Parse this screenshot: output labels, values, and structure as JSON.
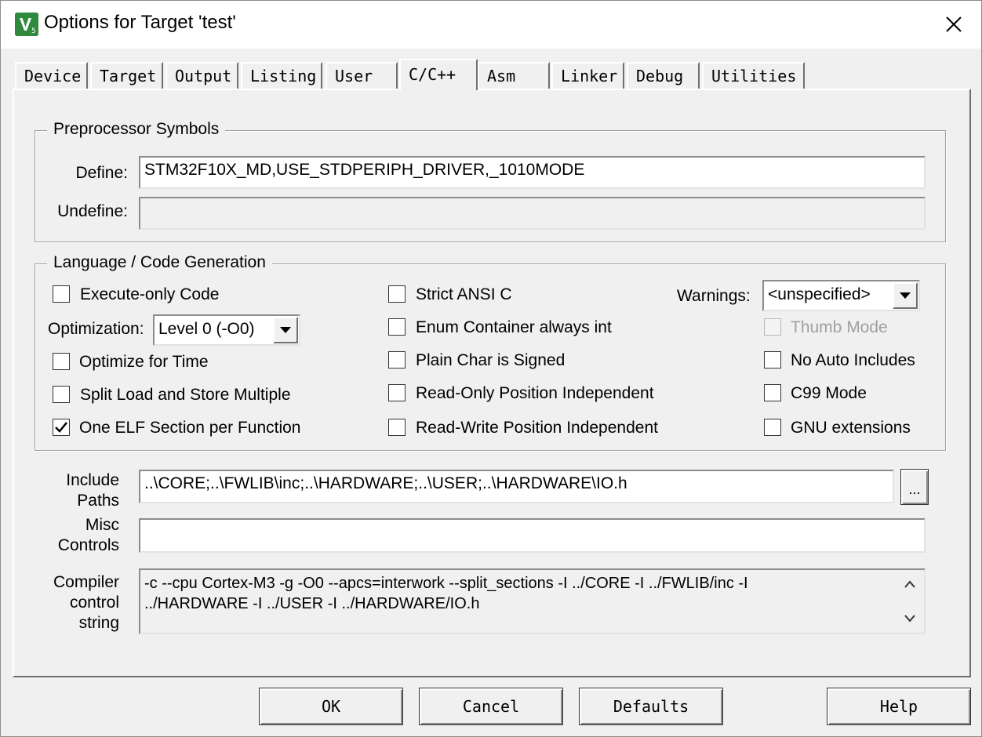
{
  "window": {
    "title": "Options for Target 'test'"
  },
  "tabs": [
    {
      "label": "Device"
    },
    {
      "label": "Target"
    },
    {
      "label": "Output"
    },
    {
      "label": "Listing"
    },
    {
      "label": "User"
    },
    {
      "label": "C/C++",
      "active": true
    },
    {
      "label": "Asm"
    },
    {
      "label": "Linker"
    },
    {
      "label": "Debug"
    },
    {
      "label": "Utilities"
    }
  ],
  "preprocessor": {
    "title": "Preprocessor Symbols",
    "define_label": "Define:",
    "define_value": "STM32F10X_MD,USE_STDPERIPH_DRIVER,_1010MODE",
    "undefine_label": "Undefine:",
    "undefine_value": ""
  },
  "language": {
    "title": "Language / Code Generation",
    "execute_only": {
      "label": "Execute-only Code",
      "checked": false
    },
    "optimization_label": "Optimization:",
    "optimization_value": "Level 0 (-O0)",
    "optimize_time": {
      "label": "Optimize for Time",
      "checked": false
    },
    "split_load": {
      "label": "Split Load and Store Multiple",
      "checked": false
    },
    "one_elf": {
      "label": "One ELF Section per Function",
      "checked": true
    },
    "strict_ansi": {
      "label": "Strict ANSI C",
      "checked": false
    },
    "enum_container": {
      "label": "Enum Container always int",
      "checked": false
    },
    "plain_char": {
      "label": "Plain Char is Signed",
      "checked": false
    },
    "ropi": {
      "label": "Read-Only Position Independent",
      "checked": false
    },
    "rwpi": {
      "label": "Read-Write Position Independent",
      "checked": false
    },
    "warnings_label": "Warnings:",
    "warnings_value": "<unspecified>",
    "thumb_mode": {
      "label": "Thumb Mode",
      "checked": false,
      "disabled": true
    },
    "no_auto_includes": {
      "label": "No Auto Includes",
      "checked": false
    },
    "c99_mode": {
      "label": "C99 Mode",
      "checked": false
    },
    "gnu_ext": {
      "label": "GNU extensions",
      "checked": false
    }
  },
  "include": {
    "label_line1": "Include",
    "label_line2": "Paths",
    "value": "..\\CORE;..\\FWLIB\\inc;..\\HARDWARE;..\\USER;..\\HARDWARE\\IO.h",
    "browse_label": "..."
  },
  "misc": {
    "label_line1": "Misc",
    "label_line2": "Controls",
    "value": ""
  },
  "compiler": {
    "label_line1": "Compiler",
    "label_line2": "control",
    "label_line3": "string",
    "line1": "-c --cpu Cortex-M3 -g -O0 --apcs=interwork --split_sections -I ../CORE -I ../FWLIB/inc -I",
    "line2": "../HARDWARE -I ../USER -I ../HARDWARE/IO.h"
  },
  "buttons": {
    "ok": "OK",
    "cancel": "Cancel",
    "defaults": "Defaults",
    "help": "Help"
  }
}
